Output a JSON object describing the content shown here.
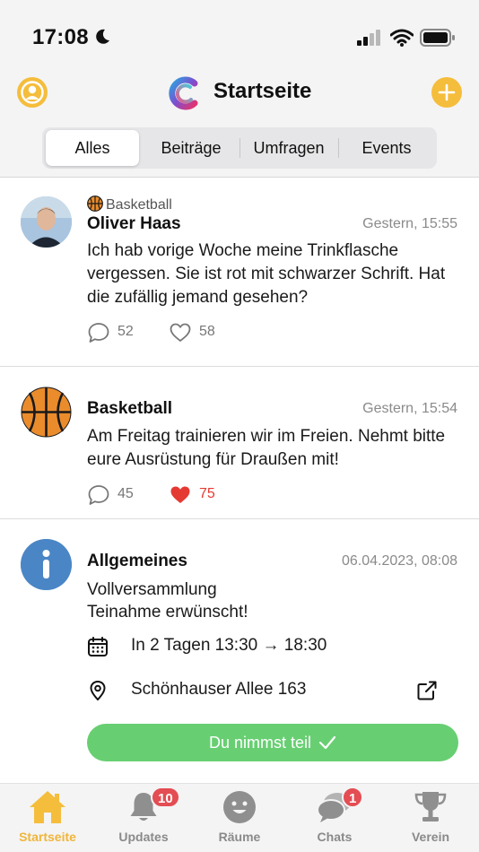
{
  "status_bar": {
    "time": "17:08"
  },
  "header": {
    "title": "Startseite"
  },
  "segments": [
    "Alles",
    "Beiträge",
    "Umfragen",
    "Events"
  ],
  "posts": [
    {
      "room": "Basketball",
      "author": "Oliver Haas",
      "time": "Gestern, 15:55",
      "text": "Ich hab vorige Woche meine Trinkflasche vergessen. Sie ist rot mit schwarzer Schrift. Hat die zufällig jemand gesehen?",
      "comments": "52",
      "likes": "58"
    },
    {
      "author": "Basketball",
      "time": "Gestern, 15:54",
      "text": "Am Freitag trainieren wir im Freien. Nehmt bitte eure Ausrüstung für Draußen mit!",
      "comments": "45",
      "likes": "75"
    },
    {
      "author": "Allgemeines",
      "time": "06.04.2023, 08:08",
      "title_line": "Vollversammlung",
      "text": "Teinahme erwünscht!",
      "date_text": "In 2 Tagen 13:30 → 18:30",
      "location": "Schönhauser Allee 163",
      "join_label": "Du nimmst teil"
    }
  ],
  "tabbar": [
    {
      "label": "Startseite",
      "icon": "home-icon"
    },
    {
      "label": "Updates",
      "icon": "bell-icon",
      "badge": "10"
    },
    {
      "label": "Räume",
      "icon": "smiley-icon"
    },
    {
      "label": "Chats",
      "icon": "chat-bubbles-icon",
      "badge": "1"
    },
    {
      "label": "Verein",
      "icon": "trophy-icon"
    }
  ],
  "colors": {
    "accent": "#f5bd3c",
    "like": "#e53a32",
    "join": "#67cf72",
    "info": "#4a86c5",
    "badge": "#e34d53"
  }
}
